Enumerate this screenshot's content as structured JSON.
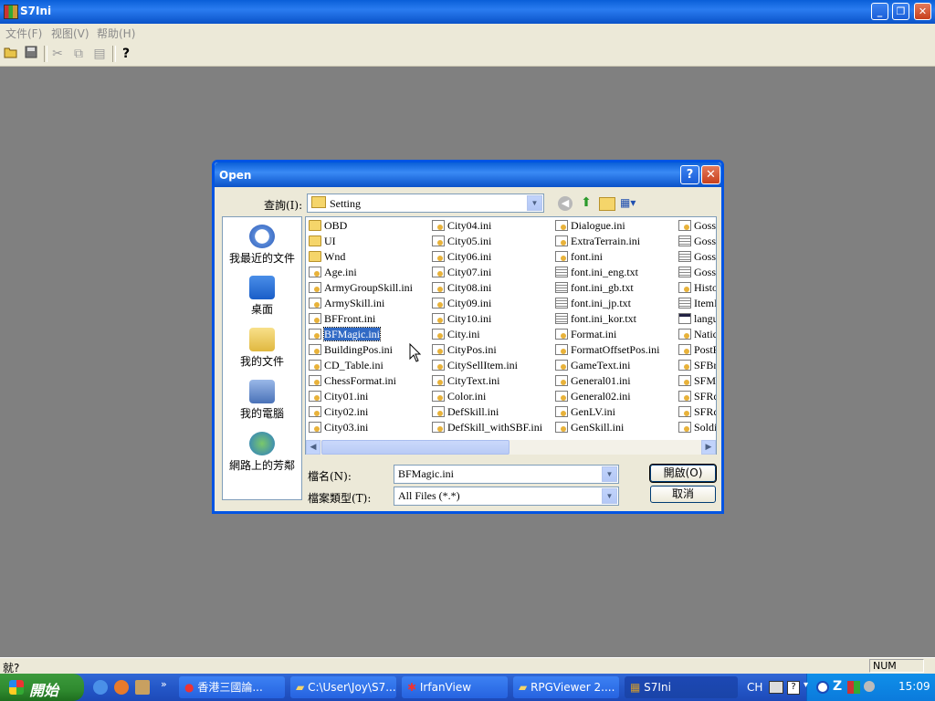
{
  "app": {
    "title": "S7Ini",
    "menu": [
      "文件(F)",
      "视图(V)",
      "帮助(H)"
    ],
    "toolbar_icons": [
      "open-folder-icon",
      "save-icon",
      "cut-icon",
      "copy-icon",
      "paste-icon",
      "help-icon"
    ],
    "status_text": "就?",
    "status_indicator": "NUM"
  },
  "dialog": {
    "title": "Open",
    "help_glyph": "?",
    "close_glyph": "✕",
    "lookin_label": "查詢(I):",
    "lookin_value": "Setting",
    "places": [
      "我最近的文件",
      "桌面",
      "我的文件",
      "我的電腦",
      "網路上的芳鄰"
    ],
    "files": [
      [
        {
          "name": "OBD",
          "type": "folder"
        },
        {
          "name": "UI",
          "type": "folder"
        },
        {
          "name": "Wnd",
          "type": "folder"
        },
        {
          "name": "Age.ini",
          "type": "ini"
        },
        {
          "name": "ArmyGroupSkill.ini",
          "type": "ini"
        },
        {
          "name": "ArmySkill.ini",
          "type": "ini"
        },
        {
          "name": "BFFront.ini",
          "type": "ini"
        },
        {
          "name": "BFMagic.ini",
          "type": "ini",
          "selected": true
        },
        {
          "name": "BuildingPos.ini",
          "type": "ini"
        },
        {
          "name": "CD_Table.ini",
          "type": "ini"
        },
        {
          "name": "ChessFormat.ini",
          "type": "ini"
        },
        {
          "name": "City01.ini",
          "type": "ini"
        },
        {
          "name": "City02.ini",
          "type": "ini"
        },
        {
          "name": "City03.ini",
          "type": "ini"
        }
      ],
      [
        {
          "name": "City04.ini",
          "type": "ini"
        },
        {
          "name": "City05.ini",
          "type": "ini"
        },
        {
          "name": "City06.ini",
          "type": "ini"
        },
        {
          "name": "City07.ini",
          "type": "ini"
        },
        {
          "name": "City08.ini",
          "type": "ini"
        },
        {
          "name": "City09.ini",
          "type": "ini"
        },
        {
          "name": "City10.ini",
          "type": "ini"
        },
        {
          "name": "City.ini",
          "type": "ini"
        },
        {
          "name": "CityPos.ini",
          "type": "ini"
        },
        {
          "name": "CitySellItem.ini",
          "type": "ini"
        },
        {
          "name": "CityText.ini",
          "type": "ini"
        },
        {
          "name": "Color.ini",
          "type": "ini"
        },
        {
          "name": "DefSkill.ini",
          "type": "ini"
        },
        {
          "name": "DefSkill_withSBF.ini",
          "type": "ini"
        }
      ],
      [
        {
          "name": "Dialogue.ini",
          "type": "ini"
        },
        {
          "name": "ExtraTerrain.ini",
          "type": "ini"
        },
        {
          "name": "font.ini",
          "type": "ini"
        },
        {
          "name": "font.ini_eng.txt",
          "type": "txt"
        },
        {
          "name": "font.ini_gb.txt",
          "type": "txt"
        },
        {
          "name": "font.ini_jp.txt",
          "type": "txt"
        },
        {
          "name": "font.ini_kor.txt",
          "type": "txt"
        },
        {
          "name": "Format.ini",
          "type": "ini"
        },
        {
          "name": "FormatOffsetPos.ini",
          "type": "ini"
        },
        {
          "name": "GameText.ini",
          "type": "ini"
        },
        {
          "name": "General01.ini",
          "type": "ini"
        },
        {
          "name": "General02.ini",
          "type": "ini"
        },
        {
          "name": "GenLV.ini",
          "type": "ini"
        },
        {
          "name": "GenSkill.ini",
          "type": "ini"
        }
      ],
      [
        {
          "name": "Goss",
          "type": "ini"
        },
        {
          "name": "Goss",
          "type": "txt"
        },
        {
          "name": "Goss",
          "type": "txt"
        },
        {
          "name": "Goss",
          "type": "txt"
        },
        {
          "name": "Histo",
          "type": "ini"
        },
        {
          "name": "ItemI",
          "type": "txt"
        },
        {
          "name": "langu",
          "type": "cfg"
        },
        {
          "name": "Natic",
          "type": "ini"
        },
        {
          "name": "PostF",
          "type": "ini"
        },
        {
          "name": "SFBr",
          "type": "ini"
        },
        {
          "name": "SFM",
          "type": "ini"
        },
        {
          "name": "SFRc",
          "type": "ini"
        },
        {
          "name": "SFRc",
          "type": "ini"
        },
        {
          "name": "Soldi",
          "type": "ini"
        }
      ]
    ],
    "filename_label": "檔名(N):",
    "filename_value": "BFMagic.ini",
    "filetype_label": "檔案類型(T):",
    "filetype_value": "All Files (*.*)",
    "open_button": "開啟(O)",
    "cancel_button": "取消"
  },
  "taskbar": {
    "start_label": "開始",
    "tasks": [
      "香港三國論...",
      "C:\\User\\Joy\\S7...",
      "IrfanView",
      "RPGViewer 2....",
      "S7Ini"
    ],
    "tray_lang": "CH",
    "clock": "15:09"
  }
}
